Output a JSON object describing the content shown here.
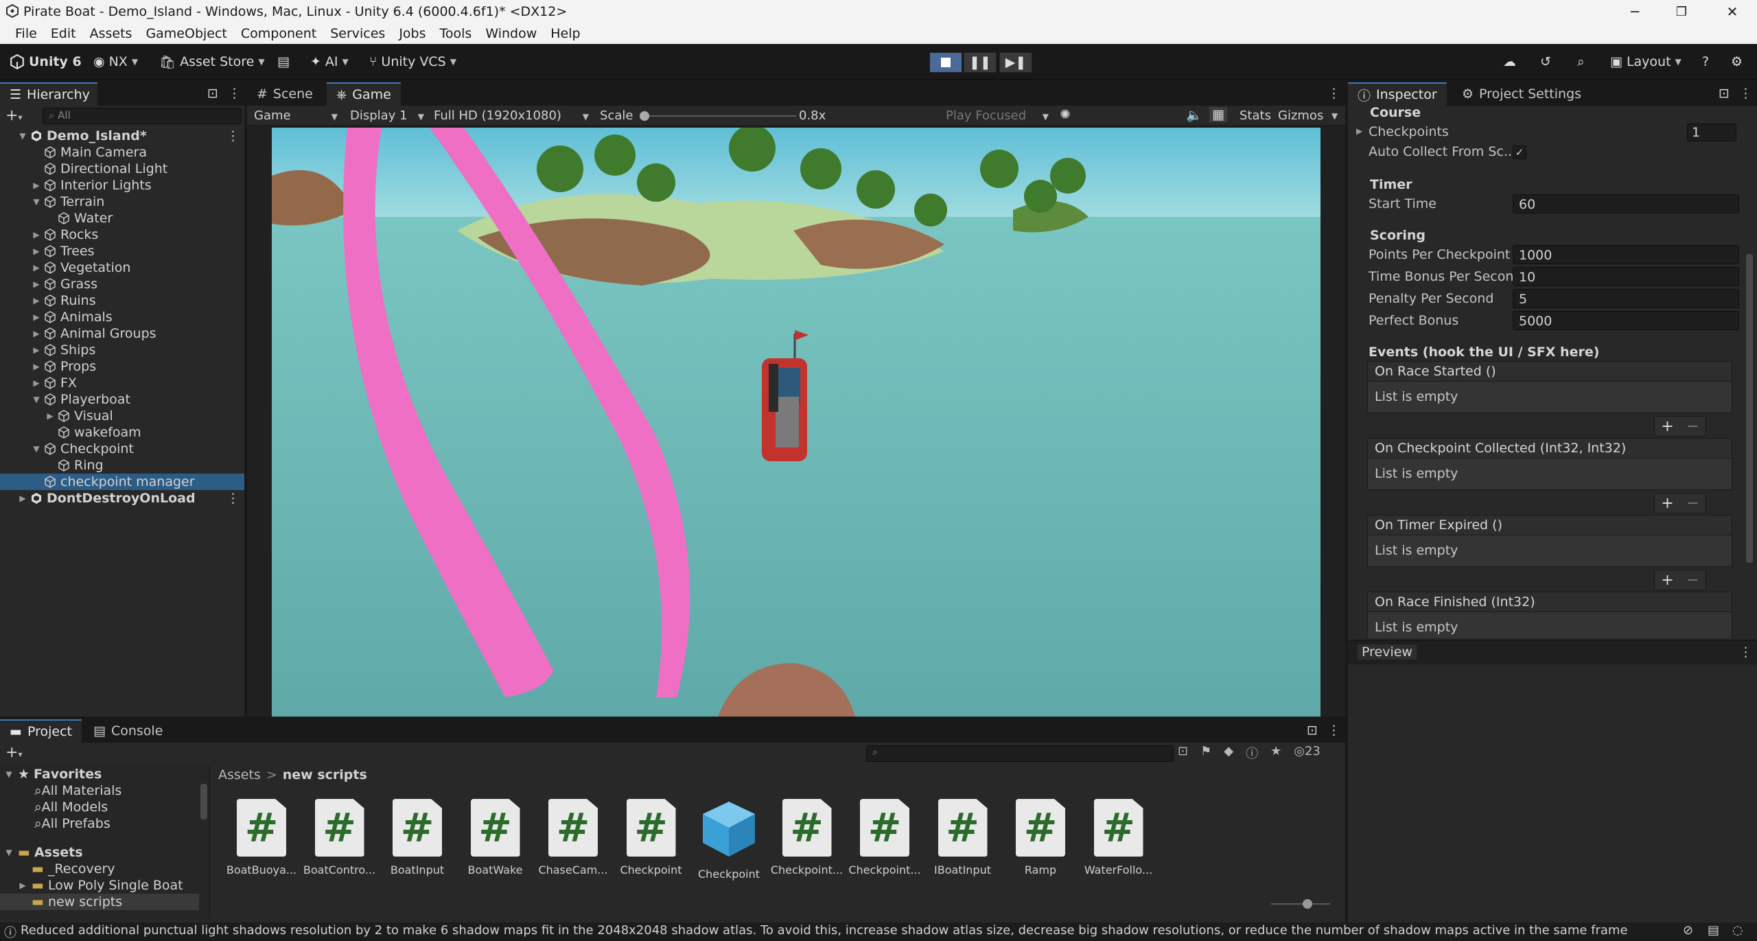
{
  "window": {
    "title": "Pirate Boat - Demo_Island - Windows, Mac, Linux - Unity 6.4 (6000.4.6f1)* <DX12>",
    "min": "─",
    "max": "❐",
    "close": "✕"
  },
  "menu": [
    "File",
    "Edit",
    "Assets",
    "GameObject",
    "Component",
    "Services",
    "Jobs",
    "Tools",
    "Window",
    "Help"
  ],
  "toolbar": {
    "brand": "Unity 6",
    "account": "NX",
    "asset_store": "Asset Store",
    "ai": "AI",
    "vcs": "Unity VCS",
    "layout": "Layout"
  },
  "hierarchy": {
    "tab": "Hierarchy",
    "search_placeholder": "All",
    "rows": [
      {
        "label": "Demo_Island*",
        "arrow": "▼",
        "indent": 0,
        "scene": true
      },
      {
        "label": "Main Camera",
        "arrow": "",
        "indent": 1
      },
      {
        "label": "Directional Light",
        "arrow": "",
        "indent": 1
      },
      {
        "label": "Interior Lights",
        "arrow": "▶",
        "indent": 1
      },
      {
        "label": "Terrain",
        "arrow": "▼",
        "indent": 1
      },
      {
        "label": "Water",
        "arrow": "",
        "indent": 2
      },
      {
        "label": "Rocks",
        "arrow": "▶",
        "indent": 1
      },
      {
        "label": "Trees",
        "arrow": "▶",
        "indent": 1
      },
      {
        "label": "Vegetation",
        "arrow": "▶",
        "indent": 1
      },
      {
        "label": "Grass",
        "arrow": "▶",
        "indent": 1
      },
      {
        "label": "Ruins",
        "arrow": "▶",
        "indent": 1
      },
      {
        "label": "Animals",
        "arrow": "▶",
        "indent": 1
      },
      {
        "label": "Animal Groups",
        "arrow": "▶",
        "indent": 1
      },
      {
        "label": "Ships",
        "arrow": "▶",
        "indent": 1
      },
      {
        "label": "Props",
        "arrow": "▶",
        "indent": 1
      },
      {
        "label": "FX",
        "arrow": "▶",
        "indent": 1
      },
      {
        "label": "Playerboat",
        "arrow": "▼",
        "indent": 1
      },
      {
        "label": "Visual",
        "arrow": "▶",
        "indent": 2
      },
      {
        "label": "wakefoam",
        "arrow": "",
        "indent": 2
      },
      {
        "label": "Checkpoint",
        "arrow": "▼",
        "indent": 1
      },
      {
        "label": "Ring",
        "arrow": "",
        "indent": 2
      },
      {
        "label": "checkpoint manager",
        "arrow": "",
        "indent": 1,
        "selected": true
      },
      {
        "label": "DontDestroyOnLoad",
        "arrow": "▶",
        "indent": 0,
        "scene": true
      }
    ]
  },
  "view": {
    "tab_scene": "Scene",
    "tab_game": "Game",
    "mode": "Game",
    "display": "Display 1",
    "resolution": "Full HD (1920x1080)",
    "scale_label": "Scale",
    "scale_value": "0.8x",
    "play_focused": "Play Focused",
    "stats": "Stats",
    "gizmos": "Gizmos"
  },
  "inspector": {
    "tab": "Inspector",
    "tab2": "Project Settings",
    "course_header": "Course",
    "checkpoints_label": "Checkpoints",
    "checkpoints_value": "1",
    "auto_collect_label": "Auto Collect From Sc...",
    "auto_collect_checked": "✓",
    "timer_header": "Timer",
    "start_time_label": "Start Time",
    "start_time_value": "60",
    "scoring_header": "Scoring",
    "points_label": "Points Per Checkpoint",
    "points_value": "1000",
    "time_bonus_label": "Time Bonus Per Second",
    "time_bonus_value": "10",
    "penalty_label": "Penalty Per Second",
    "penalty_value": "5",
    "perfect_label": "Perfect Bonus",
    "perfect_value": "5000",
    "events_header": "Events (hook the UI / SFX here)",
    "events": [
      {
        "name": "On Race Started ()",
        "body": "List is empty"
      },
      {
        "name": "On Checkpoint Collected (Int32, Int32)",
        "body": "List is empty"
      },
      {
        "name": "On Timer Expired ()",
        "body": "List is empty"
      },
      {
        "name": "On Race Finished (Int32)",
        "body": "List is empty"
      }
    ],
    "plus": "+",
    "minus": "−",
    "preview": "Preview"
  },
  "project": {
    "tab": "Project",
    "tab2": "Console",
    "hidden_count": "23",
    "breadcrumb_root": "Assets",
    "breadcrumb_sep": ">",
    "breadcrumb_current": "new scripts",
    "favorites_header": "Favorites",
    "favorites": [
      "All Materials",
      "All Models",
      "All Prefabs"
    ],
    "assets_header": "Assets",
    "folders": [
      "_Recovery",
      "Low Poly Single Boat",
      "new scripts"
    ],
    "assets": [
      {
        "name": "BoatBuoya...",
        "kind": "script"
      },
      {
        "name": "BoatContro...",
        "kind": "script"
      },
      {
        "name": "BoatInput",
        "kind": "script"
      },
      {
        "name": "BoatWake",
        "kind": "script"
      },
      {
        "name": "ChaseCam...",
        "kind": "script"
      },
      {
        "name": "Checkpoint",
        "kind": "script"
      },
      {
        "name": "Checkpoint",
        "kind": "prefab"
      },
      {
        "name": "Checkpoint...",
        "kind": "script"
      },
      {
        "name": "Checkpoint...",
        "kind": "script"
      },
      {
        "name": "IBoatInput",
        "kind": "script"
      },
      {
        "name": "Ramp",
        "kind": "script"
      },
      {
        "name": "WaterFollo...",
        "kind": "script"
      }
    ]
  },
  "status": {
    "message": "Reduced additional punctual light shadows resolution by 2 to make 6 shadow maps fit in the 2048x2048 shadow atlas. To avoid this, increase shadow atlas size, decrease big shadow resolutions, or reduce the number of shadow maps active in the same frame"
  },
  "colors": {
    "accent": "#3a79bb",
    "selection": "#2c5d87",
    "ring": "#ee6fc4",
    "sea": "#79c2bf"
  }
}
